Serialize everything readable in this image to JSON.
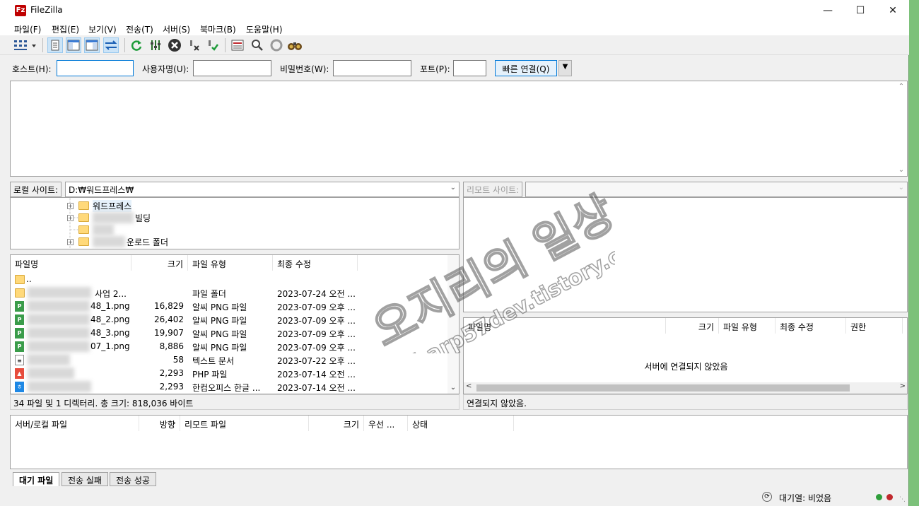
{
  "window": {
    "title": "FileZilla",
    "app_icon": "Fz"
  },
  "menu": [
    "파일(F)",
    "편집(E)",
    "보기(V)",
    "전송(T)",
    "서버(S)",
    "북마크(B)",
    "도움말(H)"
  ],
  "toolbar_icons": [
    "site-manager-icon",
    "message-log-toggle-icon",
    "local-tree-toggle-icon",
    "remote-tree-toggle-icon",
    "queue-toggle-icon",
    "refresh-icon",
    "process-queue-icon",
    "cancel-icon",
    "disconnect-icon",
    "reconnect-icon",
    "filter-icon",
    "compare-icon",
    "sync-browse-icon",
    "search-icon"
  ],
  "quickconnect": {
    "host_label": "호스트(H):",
    "user_label": "사용자명(U):",
    "pass_label": "비밀번호(W):",
    "port_label": "포트(P):",
    "connect_label": "빠른 연결(Q)",
    "host_value": "",
    "user_value": "",
    "pass_value": "",
    "port_value": ""
  },
  "local": {
    "site_label": "로컬 사이트:",
    "path": "D:₩워드프레스₩",
    "tree": [
      {
        "label": "워드프레스",
        "expander": "+"
      },
      {
        "label": "빌딩",
        "expander": "+"
      },
      {
        "label": "",
        "expander": ""
      },
      {
        "label": "운로드 폴더",
        "expander": "+"
      }
    ],
    "columns": [
      "파일명",
      "크기",
      "파일 유형",
      "최종 수정"
    ],
    "files": [
      {
        "name": "..",
        "size": "",
        "type": "",
        "modified": "",
        "icon": "folder"
      },
      {
        "name": "사업 2...",
        "size": "",
        "type": "파일 폴더",
        "modified": "2023-07-24 오전 ...",
        "icon": "folder"
      },
      {
        "name": "48_1.png",
        "size": "16,829",
        "type": "알씨 PNG 파일",
        "modified": "2023-07-09 오후 ...",
        "icon": "png"
      },
      {
        "name": "48_2.png",
        "size": "26,402",
        "type": "알씨 PNG 파일",
        "modified": "2023-07-09 오후 ...",
        "icon": "png"
      },
      {
        "name": "48_3.png",
        "size": "19,907",
        "type": "알씨 PNG 파일",
        "modified": "2023-07-09 오후 ...",
        "icon": "png"
      },
      {
        "name": "07_1.png",
        "size": "8,886",
        "type": "알씨 PNG 파일",
        "modified": "2023-07-09 오후 ...",
        "icon": "png"
      },
      {
        "name": "",
        "size": "58",
        "type": "텍스트 문서",
        "modified": "2023-07-22 오후 ...",
        "icon": "txt"
      },
      {
        "name": "",
        "size": "2,293",
        "type": "PHP 파일",
        "modified": "2023-07-14 오전 ...",
        "icon": "php"
      },
      {
        "name": "",
        "size": "2,293",
        "type": "한컴오피스 한글 ...",
        "modified": "2023-07-14 오전 ...",
        "icon": "hwp"
      }
    ],
    "status": "34 파일 및 1 디렉터리. 총 크기: 818,036 바이트"
  },
  "remote": {
    "site_label": "리모트 사이트:",
    "path": "",
    "columns": [
      "파일명",
      "크기",
      "파일 유형",
      "최종 수정",
      "권한"
    ],
    "empty_message": "서버에 연결되지 않았음",
    "status": "연결되지 않았음."
  },
  "queue": {
    "columns": [
      "서버/로컬 파일",
      "방향",
      "리모트 파일",
      "크기",
      "우선 ...",
      "상태"
    ],
    "tabs": [
      "대기 파일",
      "전송 실패",
      "전송 성공"
    ],
    "status": "대기열: 비었음"
  },
  "watermark": {
    "line1": "오지리의 일상",
    "line2": "sharp57dev.tistory.com"
  },
  "colors": {
    "accent": "#0078d7",
    "led_green": "#2e9e3a",
    "led_red": "#c0282d",
    "background": "#7cc17a"
  }
}
